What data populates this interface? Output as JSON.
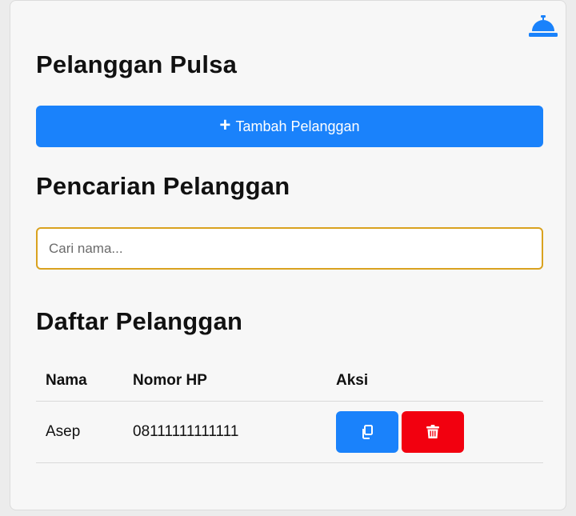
{
  "header": {
    "title": "Pelanggan Pulsa",
    "bell_icon": "bell-concierge-icon"
  },
  "actions": {
    "add_label": "Tambah Pelanggan",
    "add_icon": "plus-icon"
  },
  "search": {
    "title": "Pencarian Pelanggan",
    "placeholder": "Cari nama...",
    "value": ""
  },
  "list": {
    "title": "Daftar Pelanggan",
    "columns": [
      "Nama",
      "Nomor HP",
      "Aksi"
    ],
    "rows": [
      {
        "name": "Asep",
        "phone": "08111111111111",
        "copy_icon": "copy-icon",
        "delete_icon": "trash-icon"
      }
    ]
  },
  "colors": {
    "primary": "#1a82fb",
    "danger": "#f2000f",
    "search_border": "#d9a21f"
  }
}
